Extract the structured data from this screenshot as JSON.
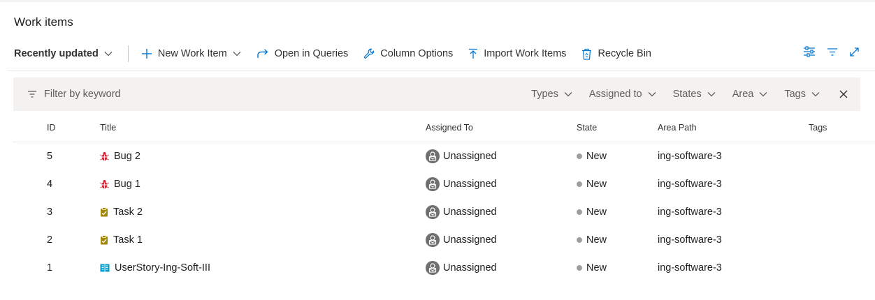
{
  "page": {
    "title": "Work items"
  },
  "toolbar": {
    "view_picker_label": "Recently updated",
    "new_work_item_label": "New Work Item",
    "open_in_queries_label": "Open in Queries",
    "column_options_label": "Column Options",
    "import_label": "Import Work Items",
    "recycle_bin_label": "Recycle Bin",
    "right_icons": [
      "view-options-icon",
      "filter-icon",
      "fullscreen-icon"
    ]
  },
  "filter": {
    "keyword_placeholder": "Filter by keyword",
    "dropdowns": [
      "Types",
      "Assigned to",
      "States",
      "Area",
      "Tags"
    ]
  },
  "grid": {
    "columns": [
      "ID",
      "Title",
      "Assigned To",
      "State",
      "Area Path",
      "Tags"
    ],
    "rows": [
      {
        "id": "5",
        "type": "bug",
        "title": "Bug 2",
        "assigned": "Unassigned",
        "state": "New",
        "area": "ing-software-3",
        "tags": ""
      },
      {
        "id": "4",
        "type": "bug",
        "title": "Bug 1",
        "assigned": "Unassigned",
        "state": "New",
        "area": "ing-software-3",
        "tags": ""
      },
      {
        "id": "3",
        "type": "task",
        "title": "Task 2",
        "assigned": "Unassigned",
        "state": "New",
        "area": "ing-software-3",
        "tags": ""
      },
      {
        "id": "2",
        "type": "task",
        "title": "Task 1",
        "assigned": "Unassigned",
        "state": "New",
        "area": "ing-software-3",
        "tags": ""
      },
      {
        "id": "1",
        "type": "user-story",
        "title": "UserStory-Ing-Soft-III",
        "assigned": "Unassigned",
        "state": "New",
        "area": "ing-software-3",
        "tags": ""
      }
    ]
  },
  "colors": {
    "bug": "#cc293d",
    "task": "#a4880a",
    "user_story": "#009ccc",
    "state_new": "#a19f9d",
    "accent": "#0078d4"
  }
}
